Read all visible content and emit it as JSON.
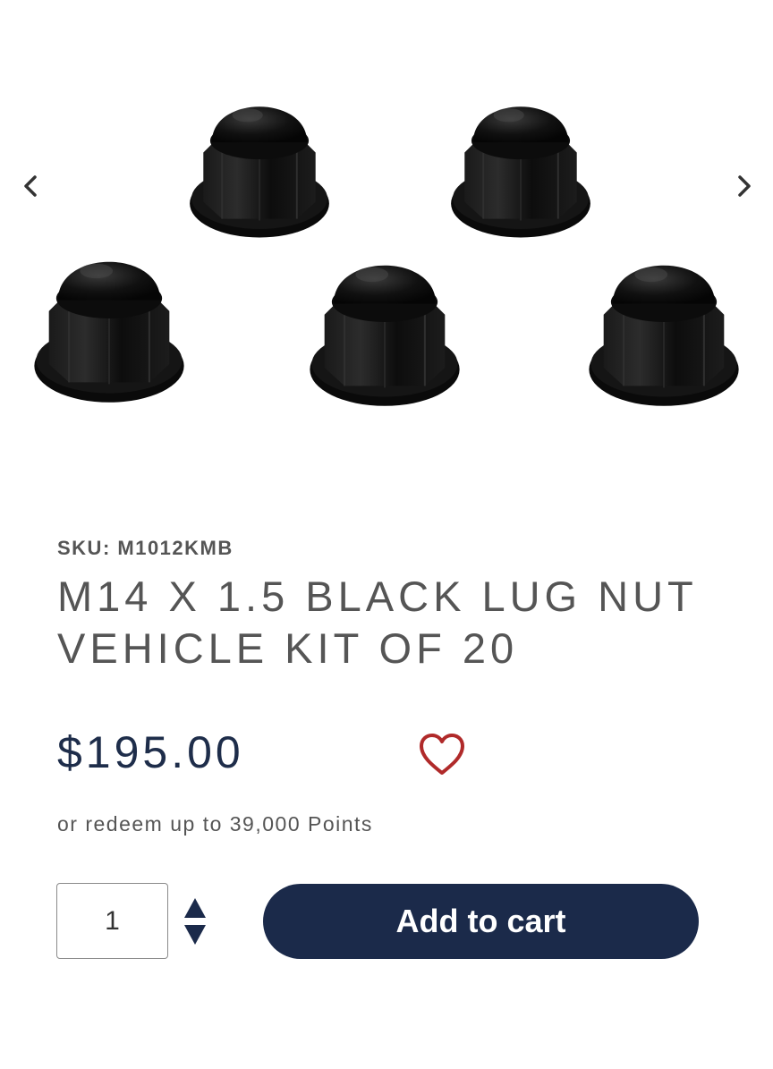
{
  "product": {
    "sku": "SKU: M1012KMB",
    "title": "M14 X 1.5 BLACK LUG NUT VEHICLE KIT OF 20",
    "price": "$195.00",
    "points_text": "or redeem up to 39,000 Points"
  },
  "gallery": {
    "prev_icon": "chevron-left-icon",
    "next_icon": "chevron-right-icon",
    "image_subject": "five black lug nuts"
  },
  "purchase": {
    "quantity": "1",
    "add_to_cart_label": "Add to cart",
    "wishlist_icon": "heart-icon"
  },
  "colors": {
    "brand_navy": "#1b2a4a",
    "price_navy": "#1e2d4a",
    "heart_red": "#b02a2a",
    "text_gray": "#555555"
  }
}
